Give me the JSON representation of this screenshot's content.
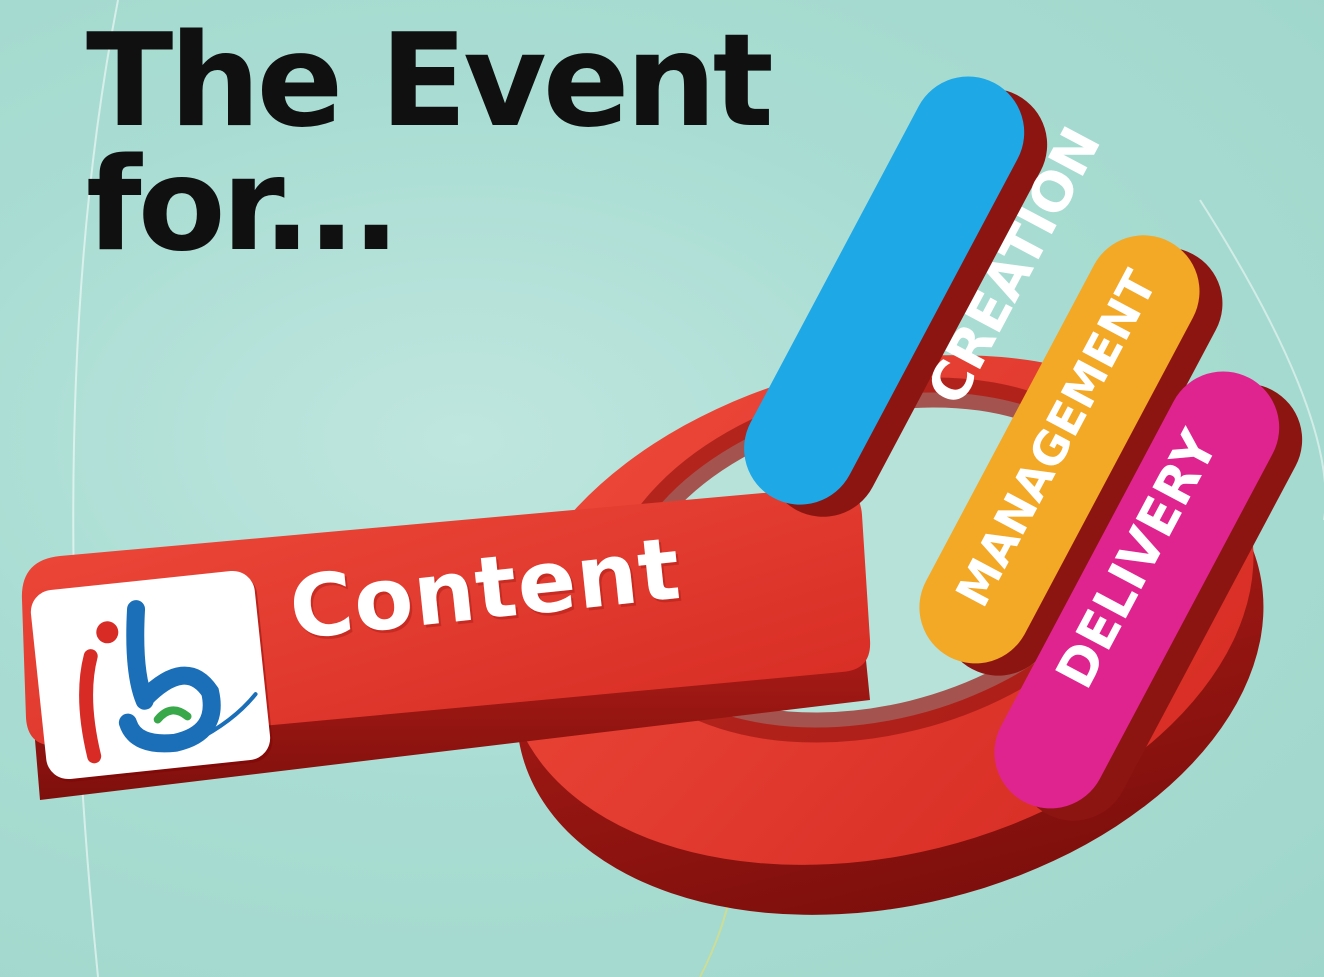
{
  "headline": {
    "line1": "The Event",
    "line2": "for..."
  },
  "main_label": "Content",
  "pills": [
    {
      "label": "CREATION",
      "color": "#1fa8e6"
    },
    {
      "label": "MANAGEMENT",
      "color": "#f3a826"
    },
    {
      "label": "DELIVERY",
      "color": "#e0248f"
    }
  ],
  "logo": {
    "text": "ibc",
    "colors": {
      "red": "#d92b26",
      "blue": "#1a6fb8",
      "green": "#38a84a"
    }
  },
  "colors": {
    "background": "#a9ddd3",
    "ring": "#e23429",
    "ring_dark": "#a81a16",
    "text_dark": "#101010"
  }
}
